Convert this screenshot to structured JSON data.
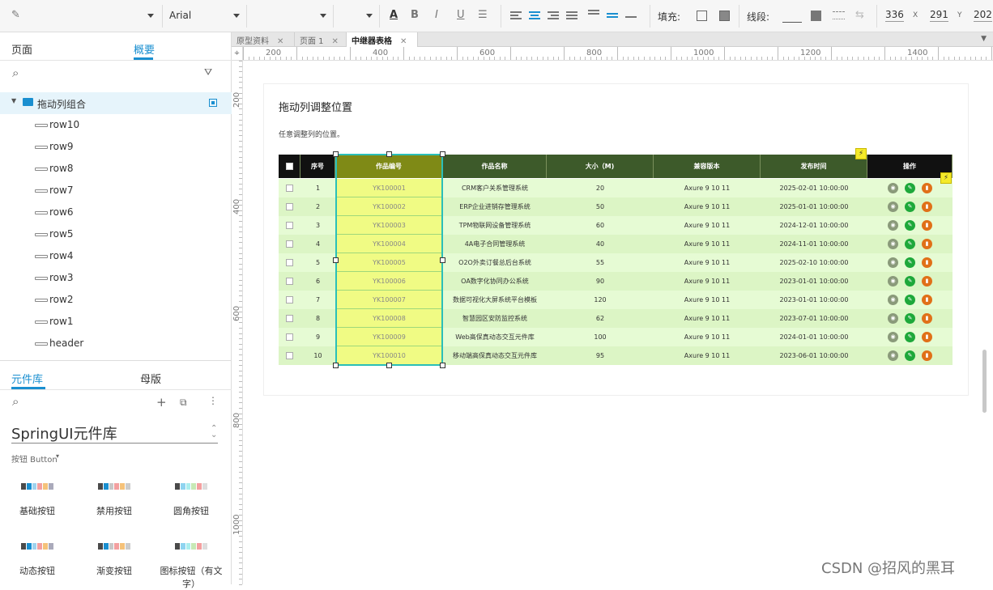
{
  "toolbar": {
    "font_family": "Arial",
    "fill_label": "填充:",
    "stroke_label": "线段:",
    "x_value": "336",
    "x_label": "X",
    "y_value": "291",
    "y_label": "Y",
    "w_value": "202"
  },
  "left_panel": {
    "tabs": {
      "pages": "页面",
      "outline": "概要"
    },
    "group_name": "拖动列组合",
    "rows": [
      "row10",
      "row9",
      "row8",
      "row7",
      "row6",
      "row5",
      "row4",
      "row3",
      "row2",
      "row1",
      "header"
    ],
    "lib_tabs": {
      "library": "元件库",
      "master": "母版"
    },
    "library_name": "SpringUI元件库",
    "category": "按钮 Button",
    "components": [
      {
        "label": "基础按钮"
      },
      {
        "label": "禁用按钮"
      },
      {
        "label": "圆角按钮"
      },
      {
        "label": "动态按钮"
      },
      {
        "label": "渐变按钮"
      },
      {
        "label": "图标按钮（有文字）"
      }
    ]
  },
  "doc_tabs": [
    {
      "label": "原型资料",
      "active": false
    },
    {
      "label": "页面 1",
      "active": false
    },
    {
      "label": "中继器表格",
      "active": true
    }
  ],
  "ruler_h": [
    "200",
    "400",
    "600",
    "800",
    "1000",
    "1200",
    "1400"
  ],
  "ruler_v": [
    "200",
    "400",
    "600",
    "800",
    "1000"
  ],
  "canvas": {
    "title": "拖动列调整位置",
    "subtitle": "任意调整列的位置。",
    "headers": [
      "序号",
      "作品编号",
      "作品名称",
      "大小（M)",
      "兼容版本",
      "发布时间",
      "操作"
    ],
    "rows": [
      {
        "idx": "1",
        "code": "YK100001",
        "name": "CRM客户关系管理系统",
        "size": "20",
        "ver": "Axure 9 10 11",
        "date": "2025-02-01 10:00:00"
      },
      {
        "idx": "2",
        "code": "YK100002",
        "name": "ERP企业进销存管理系统",
        "size": "50",
        "ver": "Axure 9 10 11",
        "date": "2025-01-01 10:00:00"
      },
      {
        "idx": "3",
        "code": "YK100003",
        "name": "TPM物联网设备管理系统",
        "size": "60",
        "ver": "Axure 9 10 11",
        "date": "2024-12-01 10:00:00"
      },
      {
        "idx": "4",
        "code": "YK100004",
        "name": "4A电子合同管理系统",
        "size": "40",
        "ver": "Axure 9 10 11",
        "date": "2024-11-01 10:00:00"
      },
      {
        "idx": "5",
        "code": "YK100005",
        "name": "O2O外卖订餐总后台系统",
        "size": "55",
        "ver": "Axure 9 10 11",
        "date": "2025-02-10 10:00:00"
      },
      {
        "idx": "6",
        "code": "YK100006",
        "name": "OA数字化协同办公系统",
        "size": "90",
        "ver": "Axure 9 10 11",
        "date": "2023-01-01 10:00:00"
      },
      {
        "idx": "7",
        "code": "YK100007",
        "name": "数据可视化大屏系统平台模板",
        "size": "120",
        "ver": "Axure 9 10 11",
        "date": "2023-01-01 10:00:00"
      },
      {
        "idx": "8",
        "code": "YK100008",
        "name": "智慧园区安防监控系统",
        "size": "62",
        "ver": "Axure 9 10 11",
        "date": "2023-07-01 10:00:00"
      },
      {
        "idx": "9",
        "code": "YK100009",
        "name": "Web高保真动态交互元件库",
        "size": "100",
        "ver": "Axure 9 10 11",
        "date": "2024-01-01 10:00:00"
      },
      {
        "idx": "10",
        "code": "YK100010",
        "name": "移动端高保真动态交互元件库",
        "size": "95",
        "ver": "Axure 9 10 11",
        "date": "2023-06-01 10:00:00"
      }
    ]
  },
  "watermark": "CSDN @招风的黑耳",
  "colors": {
    "header_bg": "#3d5a2a",
    "highlight_col": "#f0fb84",
    "row_bg": "#e6fbd4",
    "accent": "#1a8fd0"
  }
}
